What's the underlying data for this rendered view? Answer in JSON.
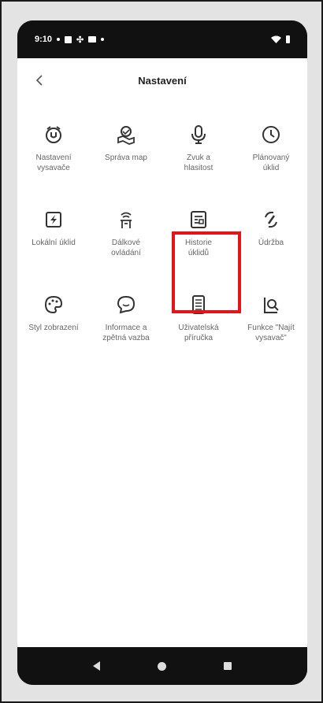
{
  "status_bar": {
    "time": "9:10"
  },
  "header": {
    "title": "Nastavení",
    "back_icon": "chevron-left-icon"
  },
  "tiles": [
    {
      "label": "Nastavení\nvysavače",
      "icon": "vacuum-settings-icon"
    },
    {
      "label": "Správa map",
      "icon": "map-management-icon"
    },
    {
      "label": "Zvuk a\nhlasitost",
      "icon": "microphone-icon"
    },
    {
      "label": "Plánovaný\núklid",
      "icon": "clock-icon"
    },
    {
      "label": "Lokální úklid",
      "icon": "local-clean-icon"
    },
    {
      "label": "Dálkové\novládání",
      "icon": "remote-control-icon"
    },
    {
      "label": "Historie\núklidů",
      "icon": "history-icon"
    },
    {
      "label": "Údržba",
      "icon": "maintenance-icon"
    },
    {
      "label": "Styl zobrazení",
      "icon": "palette-icon"
    },
    {
      "label": "Informace a\nzpětná vazba",
      "icon": "feedback-icon"
    },
    {
      "label": "Uživatelská\npříručka",
      "icon": "manual-icon"
    },
    {
      "label": "Funkce \"Najít\nvysavač\"",
      "icon": "find-vacuum-icon"
    }
  ],
  "highlight_color": "#e3141a",
  "nav": {
    "back_icon": "back-triangle-icon",
    "home_icon": "home-circle-icon",
    "recent_icon": "recent-square-icon"
  }
}
